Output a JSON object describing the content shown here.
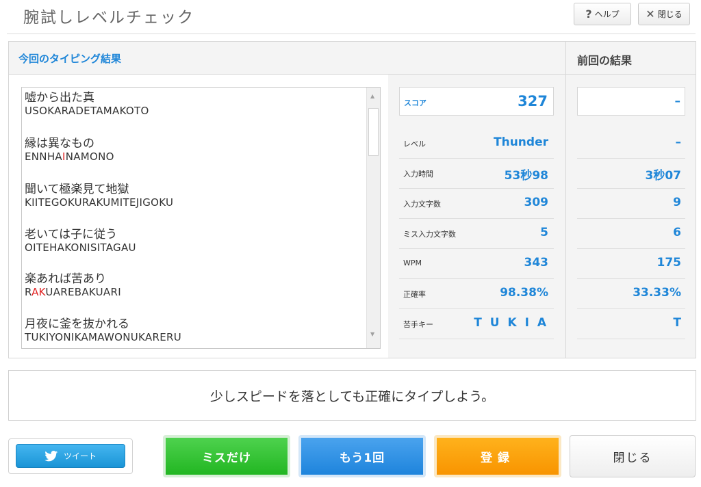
{
  "header": {
    "title": "腕試しレベルチェック",
    "help_label": "ヘルプ",
    "close_label": "閉じる"
  },
  "results": {
    "current_title": "今回のタイピング結果",
    "previous_title": "前回の結果"
  },
  "phrases": [
    {
      "jp": "嘘から出た真",
      "romaji": [
        {
          "t": "USOKARADETAMAKOTO",
          "miss": false
        }
      ]
    },
    {
      "jp": "縁は異なもの",
      "romaji": [
        {
          "t": "ENNHA",
          "miss": false
        },
        {
          "t": "I",
          "miss": true
        },
        {
          "t": "NAMONO",
          "miss": false
        }
      ]
    },
    {
      "jp": "聞いて極楽見て地獄",
      "romaji": [
        {
          "t": "KIITEGOKURAKUMITEJIGOKU",
          "miss": false
        }
      ]
    },
    {
      "jp": "老いては子に従う",
      "romaji": [
        {
          "t": "OITEHAKONISITAGAU",
          "miss": false
        }
      ]
    },
    {
      "jp": "楽あれば苦あり",
      "romaji": [
        {
          "t": "R",
          "miss": false
        },
        {
          "t": "AK",
          "miss": true
        },
        {
          "t": "UAREBAKUARI",
          "miss": false
        }
      ]
    },
    {
      "jp": "月夜に釜を抜かれる",
      "romaji": [
        {
          "t": "TUKIYONIKAMAWONUKARERU",
          "miss": false
        }
      ]
    }
  ],
  "stats": [
    {
      "key": "score",
      "label": "スコア",
      "current": "327",
      "previous": "–"
    },
    {
      "key": "level",
      "label": "レベル",
      "current": "Thunder",
      "previous": "–"
    },
    {
      "key": "input-time",
      "label": "入力時間",
      "current": "53秒98",
      "previous": "3秒07"
    },
    {
      "key": "input-chars",
      "label": "入力文字数",
      "current": "309",
      "previous": "9"
    },
    {
      "key": "miss-chars",
      "label": "ミス入力文字数",
      "current": "5",
      "previous": "6"
    },
    {
      "key": "wpm",
      "label": "WPM",
      "current": "343",
      "previous": "175"
    },
    {
      "key": "accuracy",
      "label": "正確率",
      "current": "98.38%",
      "previous": "33.33%"
    },
    {
      "key": "weak-keys",
      "label": "苦手キー",
      "current": "T U K I A",
      "previous": "T"
    }
  ],
  "advice": "少しスピードを落としても正確にタイプしよう。",
  "buttons": {
    "tweet": "ツイート",
    "miss_only": "ミスだけ",
    "again": "もう1回",
    "register": "登録",
    "close": "閉じる"
  },
  "colors": {
    "accent_blue": "#1f86d8",
    "miss_red": "#e02020",
    "green": "#22b622",
    "orange": "#f89400"
  }
}
